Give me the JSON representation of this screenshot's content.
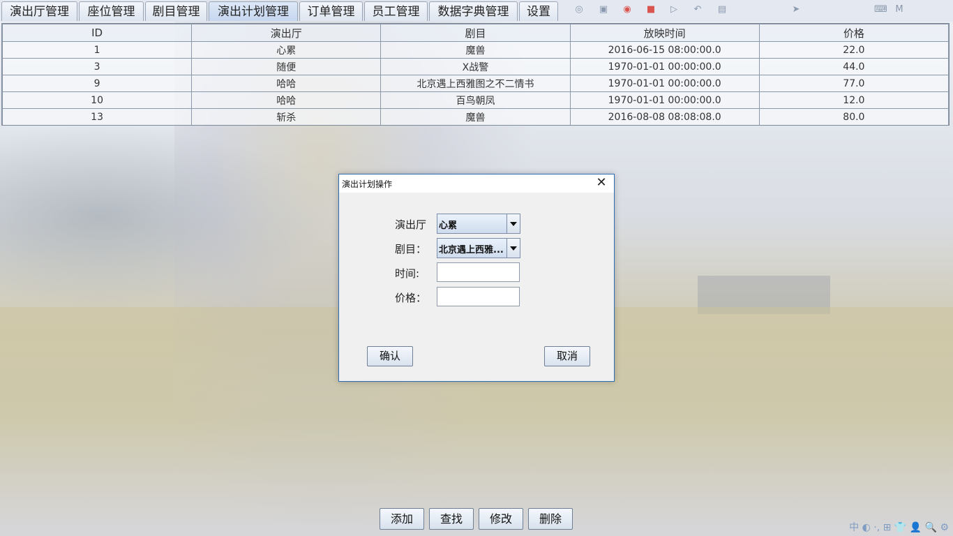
{
  "tabs": [
    {
      "label": "演出厅管理"
    },
    {
      "label": "座位管理"
    },
    {
      "label": "剧目管理"
    },
    {
      "label": "演出计划管理"
    },
    {
      "label": "订单管理"
    },
    {
      "label": "员工管理"
    },
    {
      "label": "数据字典管理"
    },
    {
      "label": "设置"
    }
  ],
  "active_tab": "演出计划管理",
  "table": {
    "columns": [
      "ID",
      "演出厅",
      "剧目",
      "放映时间",
      "价格"
    ],
    "rows": [
      [
        "1",
        "心累",
        "魔兽",
        "2016-06-15 08:00:00.0",
        "22.0"
      ],
      [
        "3",
        "随便",
        "X战警",
        "1970-01-01 00:00:00.0",
        "44.0"
      ],
      [
        "9",
        "哈哈",
        "北京遇上西雅图之不二情书",
        "1970-01-01 00:00:00.0",
        "77.0"
      ],
      [
        "10",
        "哈哈",
        "百鸟朝凤",
        "1970-01-01 00:00:00.0",
        "12.0"
      ],
      [
        "13",
        "斩杀",
        "魔兽",
        "2016-08-08 08:08:08.0",
        "80.0"
      ]
    ]
  },
  "dialog": {
    "title": "演出计划操作",
    "close_label": "✕",
    "hall_label": "演出厅",
    "hall_value": "心累",
    "play_label": "剧目：",
    "play_value": "北京遇上西雅...",
    "time_label": "时间:",
    "time_value": "",
    "price_label": "价格：",
    "price_value": "",
    "confirm_label": "确认",
    "cancel_label": "取消"
  },
  "bottom_buttons": {
    "add": "添加",
    "find": "查找",
    "modify": "修改",
    "delete": "删除"
  },
  "tray_icons": [
    "steam-icon",
    "image-icon",
    "netease-icon",
    "mail-icon",
    "play-icon",
    "back-arrow-icon",
    "photo-icon",
    "send-icon",
    "keyboard-icon",
    "m-icon"
  ],
  "ime_bar": "中 ◐ ·, ⊞ 👕 👤 🔍 ⚙",
  "colors": {
    "dialog_border": "#2d6db5",
    "active_tab": "#c5d6ef"
  }
}
